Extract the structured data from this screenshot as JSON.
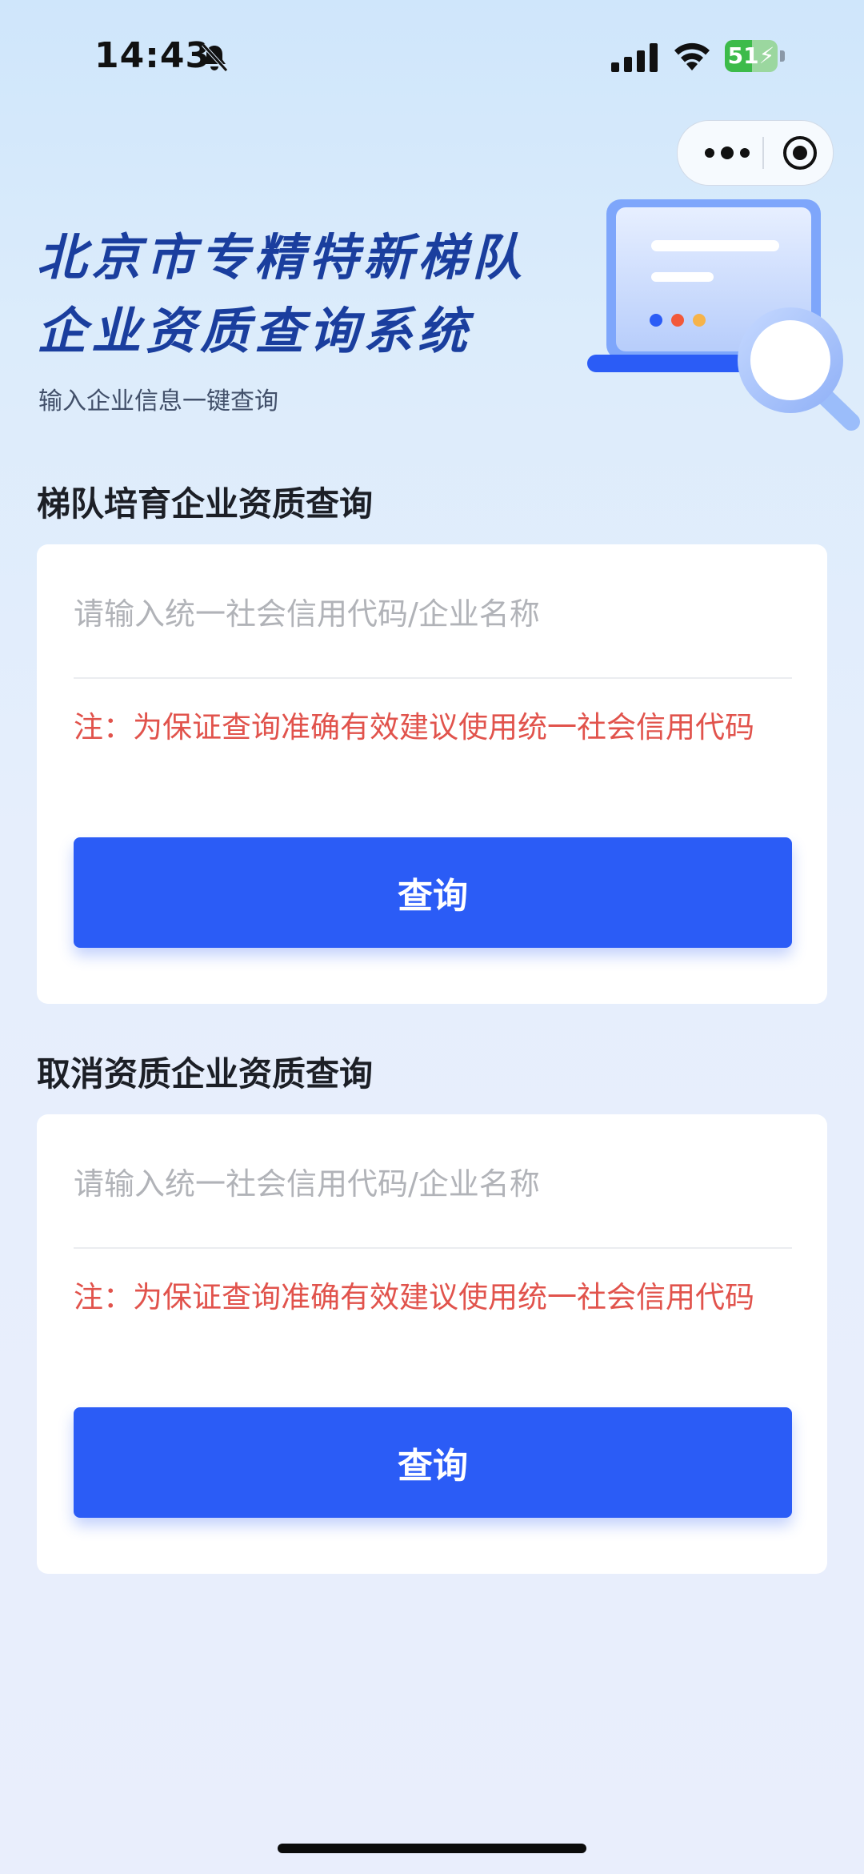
{
  "status_bar": {
    "time": "14:43",
    "battery_level": "51",
    "battery_fraction": 0.51,
    "icons": [
      "bell-muted-icon",
      "signal-icon",
      "wifi-icon",
      "battery-charging-icon"
    ]
  },
  "capsule": {
    "icons": [
      "more-dots-icon",
      "close-target-icon"
    ]
  },
  "hero": {
    "title_line1": "北京市专精特新梯队",
    "title_line2": "企业资质查询系统",
    "subtitle": "输入企业信息一键查询",
    "illustration": "laptop-magnifier-icon"
  },
  "sections": [
    {
      "title": "梯队培育企业资质查询",
      "input_placeholder": "请输入统一社会信用代码/企业名称",
      "note": "注：为保证查询准确有效建议使用统一社会信用代码",
      "button_label": "查询"
    },
    {
      "title": "取消资质企业资质查询",
      "input_placeholder": "请输入统一社会信用代码/企业名称",
      "note": "注：为保证查询准确有效建议使用统一社会信用代码",
      "button_label": "查询"
    }
  ],
  "colors": {
    "primary_button": "#2b5cf6",
    "note_text": "#e1534c",
    "hero_title": "#1a3e9e",
    "battery_green": "#3dbb4a"
  }
}
